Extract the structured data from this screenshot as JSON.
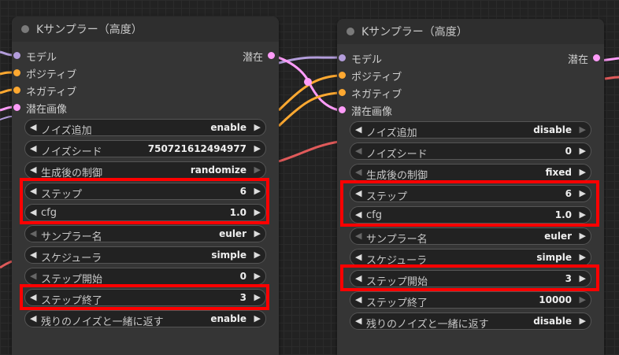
{
  "colors": {
    "model": "#b39ddb",
    "positive": "#ffa931",
    "negative": "#ffa931",
    "latent": "#ff9cf9",
    "highlight": "#ff0000",
    "wire_red": "#e05a5a"
  },
  "left_node": {
    "title": "Kサンプラー（高度）",
    "inputs": [
      "モデル",
      "ポジティブ",
      "ネガティブ",
      "潜在画像"
    ],
    "output": "潜在",
    "widgets": [
      {
        "label": "ノイズ追加",
        "value": "enable"
      },
      {
        "label": "ノイズシード",
        "value": "750721612494977"
      },
      {
        "label": "生成後の制御",
        "value": "randomize"
      },
      {
        "label": "ステップ",
        "value": "6"
      },
      {
        "label": "cfg",
        "value": "1.0"
      },
      {
        "label": "サンプラー名",
        "value": "euler"
      },
      {
        "label": "スケジューラ",
        "value": "simple"
      },
      {
        "label": "ステップ開始",
        "value": "0"
      },
      {
        "label": "ステップ終了",
        "value": "3"
      },
      {
        "label": "残りのノイズと一緒に返す",
        "value": "enable"
      }
    ]
  },
  "right_node": {
    "title": "Kサンプラー（高度）",
    "inputs": [
      "モデル",
      "ポジティブ",
      "ネガティブ",
      "潜在画像"
    ],
    "output": "潜在",
    "widgets": [
      {
        "label": "ノイズ追加",
        "value": "disable"
      },
      {
        "label": "ノイズシード",
        "value": "0"
      },
      {
        "label": "生成後の制御",
        "value": "fixed"
      },
      {
        "label": "ステップ",
        "value": "6"
      },
      {
        "label": "cfg",
        "value": "1.0"
      },
      {
        "label": "サンプラー名",
        "value": "euler"
      },
      {
        "label": "スケジューラ",
        "value": "simple"
      },
      {
        "label": "ステップ開始",
        "value": "3"
      },
      {
        "label": "ステップ終了",
        "value": "10000"
      },
      {
        "label": "残りのノイズと一緒に返す",
        "value": "disable"
      }
    ]
  },
  "arrows": {
    "left": "◀",
    "right": "▶"
  }
}
